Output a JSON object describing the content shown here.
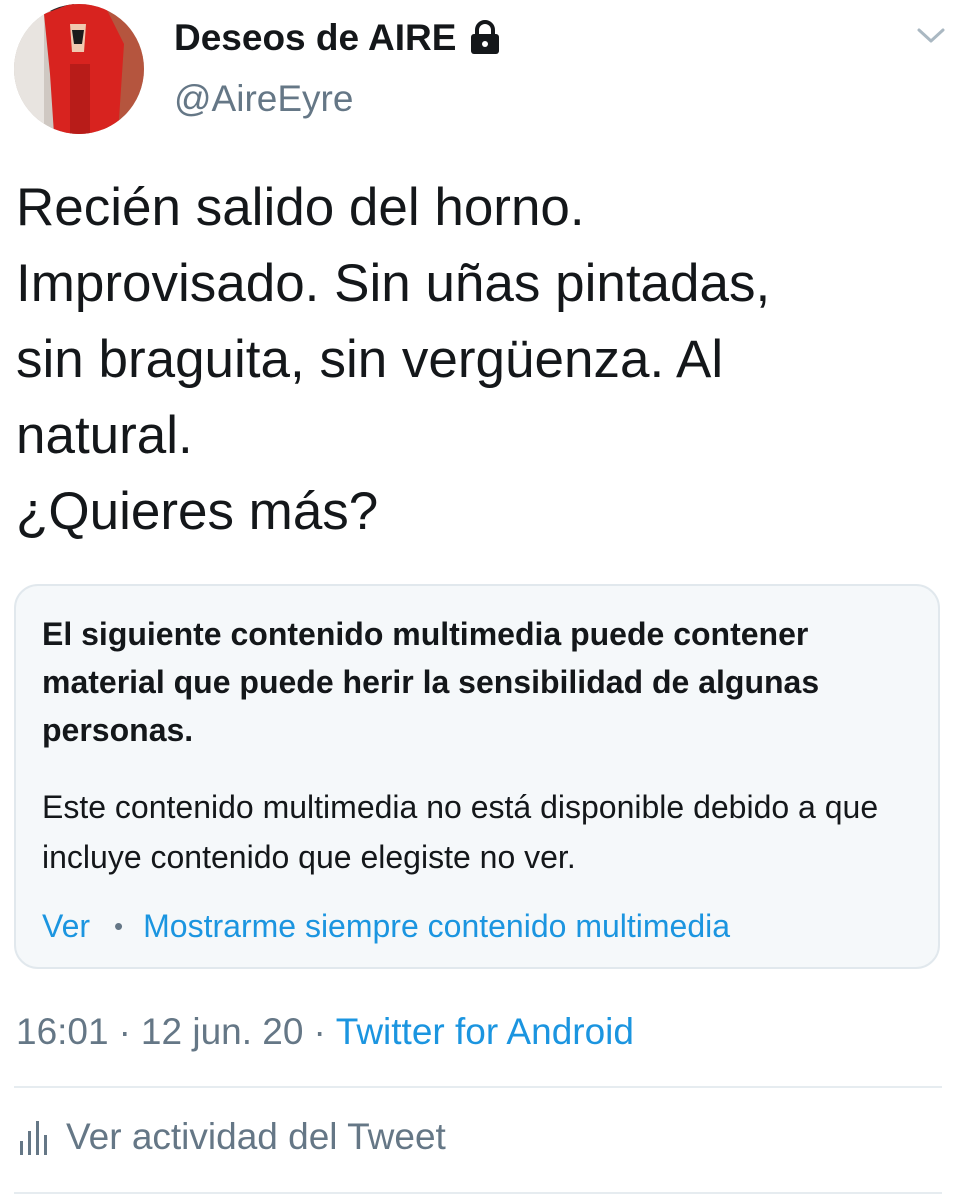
{
  "author": {
    "display_name": "Deseos de AIRE",
    "handle": "@AireEyre",
    "verified_icon": "lock-icon"
  },
  "tweet": {
    "text": "Recién salido del horno.\nImprovisado. Sin uñas pintadas,\nsin braguita, sin vergüenza. Al\nnatural.\n¿Quieres más?"
  },
  "sensitive_media": {
    "title": "El siguiente contenido multimedia puede contener material que puede herir la sensibilidad de algunas personas.",
    "body": "Este contenido multimedia no está disponible debido a que incluye contenido que elegiste no ver.",
    "view_label": "Ver",
    "separator": "•",
    "always_show_label": "Mostrarme siempre contenido multimedia"
  },
  "meta": {
    "time": "16:01",
    "sep1": "·",
    "date": "12 jun. 20",
    "sep2": "·",
    "source": "Twitter for Android"
  },
  "activity": {
    "label": "Ver actividad del Tweet",
    "icon": "bar-chart-icon"
  },
  "colors": {
    "link": "#1b95e0",
    "secondary_text": "#657786",
    "card_bg": "#f5f8fa",
    "card_border": "#e1e8ed"
  }
}
